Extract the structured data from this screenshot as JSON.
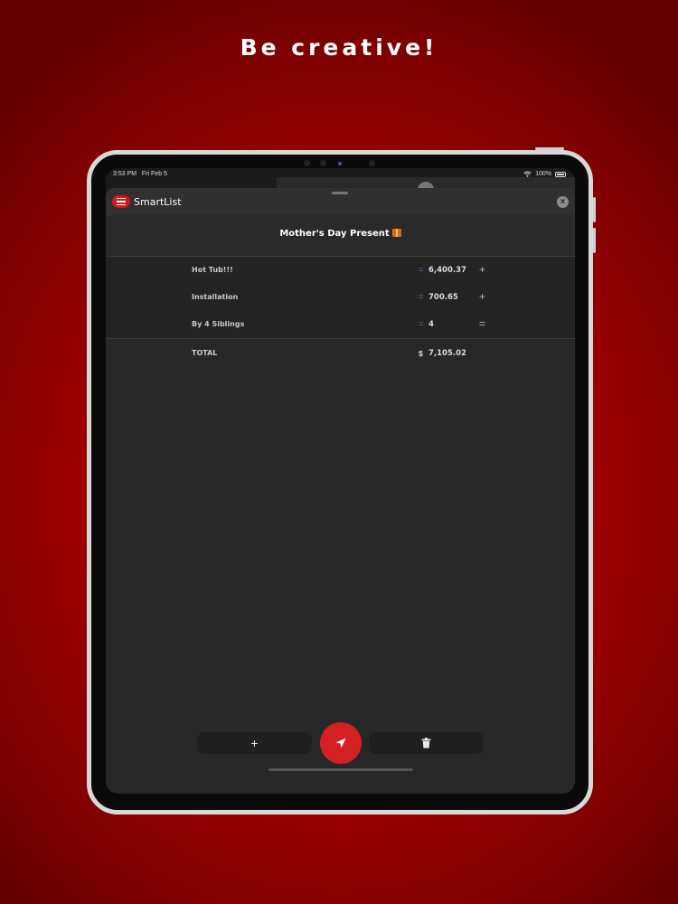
{
  "marketing": {
    "headline": "Be creative!"
  },
  "status_bar": {
    "time": "3:53 PM",
    "date": "Fri Feb 5",
    "battery": "100%"
  },
  "app": {
    "name": "SmartList",
    "close_icon": "close-icon",
    "app_icon": "list-icon"
  },
  "list": {
    "title": "Mother's Day Present",
    "items": [
      {
        "label": "Hot Tub!!!",
        "value": "6,400.37",
        "operator": "+"
      },
      {
        "label": "Installation",
        "value": "700.65",
        "operator": "+"
      },
      {
        "label": "By 4 Siblings",
        "value": "4",
        "operator": "="
      }
    ],
    "total": {
      "label": "TOTAL",
      "currency": "$",
      "value": "7,105.02"
    }
  },
  "toolbar": {
    "add_label": "+",
    "send_icon": "send-icon",
    "delete_icon": "trash-icon"
  },
  "colors": {
    "accent": "#d42020",
    "background": "#a80000",
    "equals_sign": "#3d84d6"
  }
}
